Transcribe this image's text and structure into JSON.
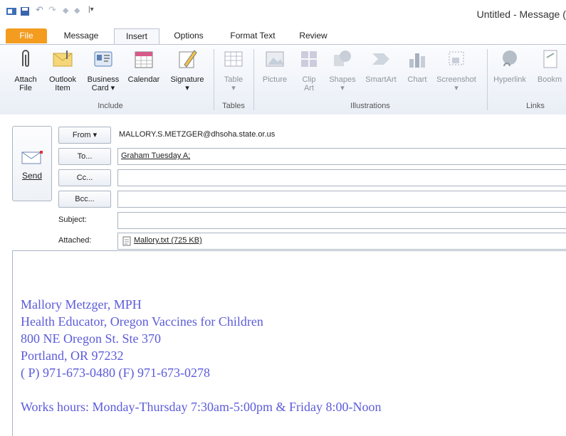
{
  "window": {
    "title": "Untitled - Message (H"
  },
  "tabs": [
    {
      "label": "File"
    },
    {
      "label": "Message"
    },
    {
      "label": "Insert"
    },
    {
      "label": "Options"
    },
    {
      "label": "Format Text"
    },
    {
      "label": "Review"
    }
  ],
  "ribbon": {
    "include": {
      "group_label": "Include",
      "attach_file": [
        "Attach",
        "File"
      ],
      "outlook_item": [
        "Outlook",
        "Item"
      ],
      "business_card": [
        "Business",
        "Card ▾"
      ],
      "calendar": "Calendar",
      "signature": "Signature"
    },
    "tables": {
      "group_label": "Tables",
      "table": "Table"
    },
    "illustrations": {
      "group_label": "Illustrations",
      "picture": "Picture",
      "clip_art": [
        "Clip",
        "Art"
      ],
      "shapes": "Shapes",
      "smartart": "SmartArt",
      "chart": "Chart",
      "screenshot": "Screenshot"
    },
    "links": {
      "group_label": "Links",
      "hyperlink": "Hyperlink",
      "bookmark": "Bookm"
    }
  },
  "compose": {
    "send_label": "Send",
    "from_label": "From ▾",
    "from_value": "MALLORY.S.METZGER@dhsoha.state.or.us",
    "to_label": "To...",
    "to_value": "Graham Tuesday A;",
    "cc_label": "Cc...",
    "cc_value": "",
    "bcc_label": "Bcc...",
    "bcc_value": "",
    "subject_label": "Subject:",
    "subject_value": "",
    "attached_label": "Attached:",
    "attachment": "Mallory.txt (725 KB)"
  },
  "signature": {
    "name": "Mallory Metzger, MPH",
    "title": "Health Educator, Oregon Vaccines for Children",
    "address1": "800 NE Oregon St. Ste 370",
    "address2": "Portland, OR 97232",
    "phones": "( P) 971-673-0480 (F) 971-673-0278",
    "hours": "Works hours: Monday-Thursday 7:30am-5:00pm & Friday 8:00-Noon"
  }
}
